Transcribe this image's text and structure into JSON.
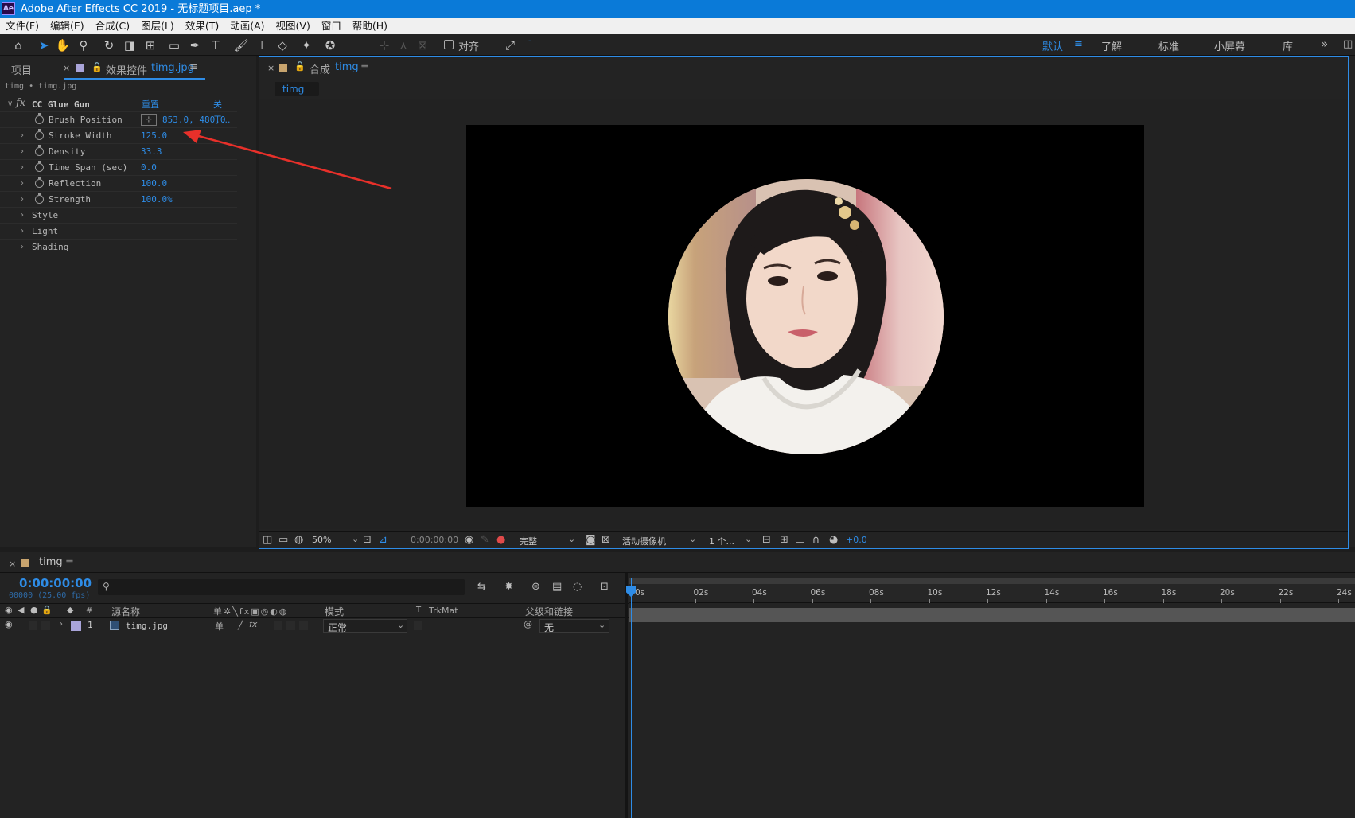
{
  "window": {
    "title": "Adobe After Effects CC 2019 - 无标题项目.aep *",
    "logo": "Ae"
  },
  "menu": [
    "文件(F)",
    "编辑(E)",
    "合成(C)",
    "图层(L)",
    "效果(T)",
    "动画(A)",
    "视图(V)",
    "窗口",
    "帮助(H)"
  ],
  "toolbar": {
    "align_label": "对齐",
    "workspaces": [
      "默认",
      "了解",
      "标准",
      "小屏幕",
      "库"
    ],
    "active_workspace": "默认"
  },
  "project_panel": {
    "tab_project": "项目",
    "tab_effects_prefix": "效果控件",
    "tab_effects_file": "timg.jpg",
    "breadcrumb": "timg • timg.jpg",
    "effect": {
      "name": "CC Glue Gun",
      "reset": "重置",
      "about": "关于...",
      "params": [
        {
          "name": "Brush Position",
          "value": "853.0, 480.0",
          "stopwatch": true,
          "expand": false,
          "point": true
        },
        {
          "name": "Stroke Width",
          "value": "125.0",
          "stopwatch": true,
          "expand": true
        },
        {
          "name": "Density",
          "value": "33.3",
          "stopwatch": true,
          "expand": true
        },
        {
          "name": "Time Span (sec)",
          "value": "0.0",
          "stopwatch": true,
          "expand": true
        },
        {
          "name": "Reflection",
          "value": "100.0",
          "stopwatch": true,
          "expand": true
        },
        {
          "name": "Strength",
          "value": "100.0%",
          "stopwatch": true,
          "expand": true
        },
        {
          "name": "Style",
          "value": "",
          "stopwatch": false,
          "expand": true
        },
        {
          "name": "Light",
          "value": "",
          "stopwatch": false,
          "expand": true
        },
        {
          "name": "Shading",
          "value": "",
          "stopwatch": false,
          "expand": true
        }
      ]
    }
  },
  "comp_panel": {
    "tab_prefix": "合成",
    "tab_name": "timg",
    "subtab": "timg",
    "footer": {
      "zoom": "50%",
      "timecode": "0:00:00:00",
      "quality": "完整",
      "camera": "活动摄像机",
      "views": "1 个...",
      "exposure": "+0.0"
    }
  },
  "timeline": {
    "tab": "timg",
    "timecode": "0:00:00:00",
    "frames": "00000 (25.00 fps)",
    "search_placeholder": "",
    "columns": {
      "hash": "#",
      "source": "源名称",
      "mode": "模式",
      "t": "T",
      "trkmat": "TrkMat",
      "parent": "父级和链接"
    },
    "ruler": [
      "0s",
      "02s",
      "04s",
      "06s",
      "08s",
      "10s",
      "12s",
      "14s",
      "16s",
      "18s",
      "20s",
      "22s",
      "24s"
    ],
    "layers": [
      {
        "index": "1",
        "name": "timg.jpg",
        "mode": "正常",
        "parent": "无"
      }
    ]
  },
  "colors": {
    "accent": "#2e8ce6",
    "titlebar": "#0a7ad8",
    "layer_label": "#a9a4d9",
    "annotation_arrow": "#e8302a"
  }
}
